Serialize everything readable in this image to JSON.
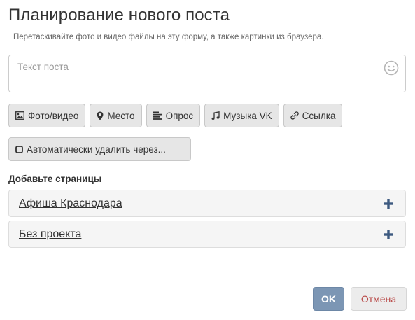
{
  "dialog": {
    "title": "Планирование нового поста",
    "hint": "Перетаскивайте фото и видео файлы на эту форму, а также картинки из браузера."
  },
  "post": {
    "placeholder": "Текст поста",
    "emoji_icon": "smile-icon"
  },
  "attachments": [
    {
      "label": "Фото/видео",
      "icon": "image-icon"
    },
    {
      "label": "Место",
      "icon": "map-marker-icon"
    },
    {
      "label": "Опрос",
      "icon": "align-left-icon"
    },
    {
      "label": "Музыка VK",
      "icon": "music-icon"
    },
    {
      "label": "Ссылка",
      "icon": "link-icon"
    }
  ],
  "auto_delete": {
    "label": "Автоматически удалить через...",
    "icon": "square-icon"
  },
  "pages": {
    "label": "Добавьте страницы",
    "items": [
      {
        "name": "Афиша Краснодара",
        "icon": "plus-icon"
      },
      {
        "name": "Без проекта",
        "icon": "plus-icon"
      }
    ]
  },
  "footer": {
    "ok_label": "OK",
    "cancel_label": "Отмена"
  },
  "colors": {
    "ok_button": "#7c96b4",
    "cancel_text": "#b94a48",
    "plus_icon": "#3d5a80"
  }
}
